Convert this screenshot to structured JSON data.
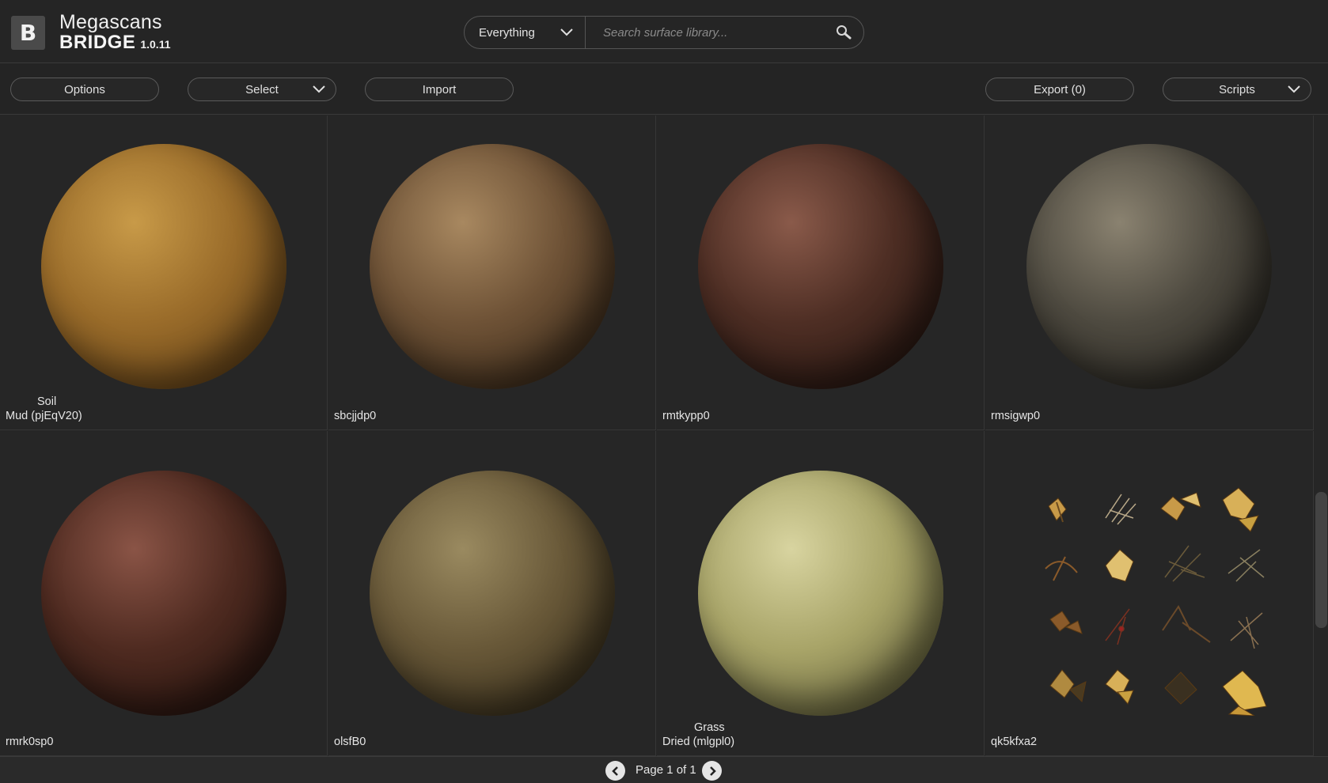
{
  "app": {
    "logo_letter": "B",
    "brand_line1": "Megascans",
    "brand_line2": "BRIDGE",
    "version": "1.0.11"
  },
  "search": {
    "category": "Everything",
    "placeholder": "Search surface library...",
    "value": ""
  },
  "toolbar": {
    "options_label": "Options",
    "select_label": "Select",
    "import_label": "Import",
    "export_label": "Export (0)",
    "scripts_label": "Scripts"
  },
  "assets": [
    {
      "category": "Soil",
      "name": "Mud (pjEqV20)",
      "colors": [
        "#c89a48",
        "#9a6c2a",
        "#5a3a14"
      ]
    },
    {
      "category": "",
      "name": "sbcjjdp0",
      "colors": [
        "#a88860",
        "#6e5236",
        "#2e2012"
      ]
    },
    {
      "category": "",
      "name": "rmtkypp0",
      "colors": [
        "#8a5a4a",
        "#4e2e24",
        "#1c100c"
      ]
    },
    {
      "category": "",
      "name": "rmsigwp0",
      "colors": [
        "#8a8270",
        "#4e4a40",
        "#1e1c18"
      ]
    },
    {
      "category": "",
      "name": "rmrk0sp0",
      "colors": [
        "#8a5446",
        "#4e2a20",
        "#1c0e0a"
      ]
    },
    {
      "category": "",
      "name": "olsfB0",
      "colors": [
        "#9a8a60",
        "#685838",
        "#2c2414"
      ]
    },
    {
      "category": "Grass",
      "name": "Dried (mlgpl0)",
      "colors": [
        "#d8d4a0",
        "#a8a468",
        "#545230"
      ]
    },
    {
      "category": "",
      "name": "qk5kfxa2",
      "colors": []
    }
  ],
  "pagination": {
    "text": "Page 1 of 1"
  },
  "icons": {
    "search": "search-icon",
    "dropdown": "chevron-down-icon",
    "prev": "chevron-left-icon",
    "next": "chevron-right-icon"
  }
}
